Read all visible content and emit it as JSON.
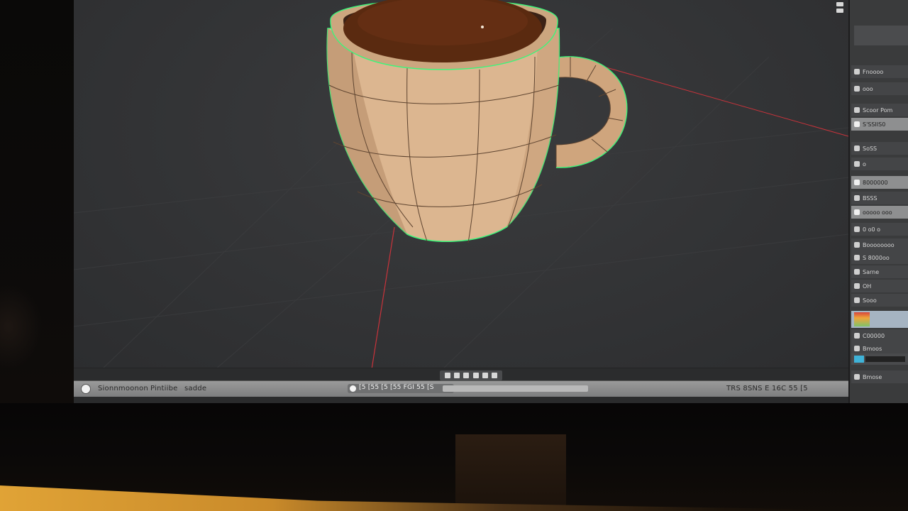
{
  "scene": {
    "subject": "",
    "colors": {
      "viewport_bg": "#363739",
      "mug_body": "#d9b48f",
      "mug_shadow": "#a67e5a",
      "coffee": "#5a2a10",
      "selection_outline": "#3ef57a",
      "axis_line": "#c9333b",
      "wire": "#5e4430"
    }
  },
  "viewport": {
    "toolbar_icons": [
      "tool-icon",
      "tool-icon",
      "tool-icon",
      "tool-icon",
      "tool-icon",
      "tool-icon"
    ]
  },
  "statusbar": {
    "left_text": "Sionnmoonon",
    "left_sub": "Pintiibe",
    "left_sub2": "sadde",
    "timeline_text": "[5 [55 [5 [55 FGI 55 [S",
    "right_text": "TRS 8SNS E 16C 55 [5"
  },
  "right_panel": {
    "rows": [
      {
        "label": "Fnoooo"
      },
      {
        "label": "ooo"
      },
      {
        "label": "Scoor Pom"
      },
      {
        "label": "S'SSIIS0"
      },
      {
        "label": "SoSS"
      },
      {
        "label": "o"
      },
      {
        "label": "8000000"
      },
      {
        "label": "BSSS"
      },
      {
        "label": "ooooo ooo"
      },
      {
        "label": "0 o0 o"
      },
      {
        "label": "Boooooooo"
      },
      {
        "label": "S 8000oo"
      },
      {
        "label": "Sarne"
      },
      {
        "label": "OH"
      },
      {
        "label": "Sooo"
      },
      {
        "label": "C00000"
      },
      {
        "label": "Bmoos"
      },
      {
        "label": "Bmose"
      }
    ]
  }
}
